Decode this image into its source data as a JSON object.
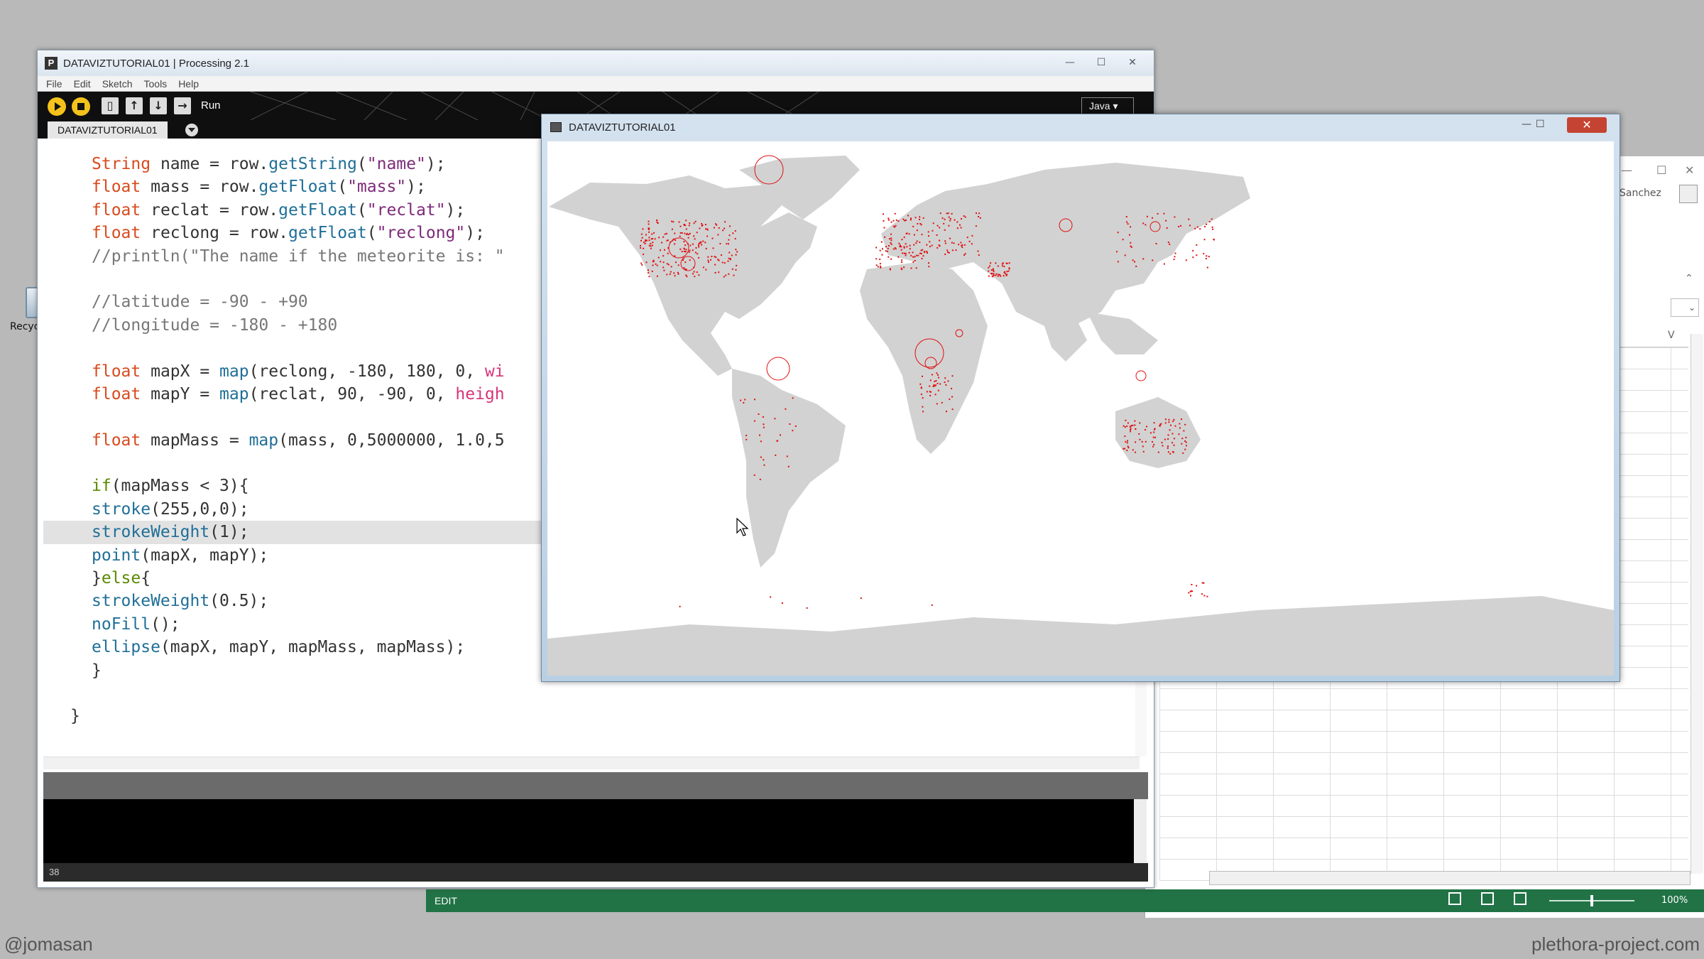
{
  "desktop": {
    "recycle_label": "Recycle"
  },
  "ide": {
    "title": "DATAVIZTUTORIAL01 | Processing 2.1",
    "menu": [
      "File",
      "Edit",
      "Sketch",
      "Tools",
      "Help"
    ],
    "run_label": "Run",
    "mode": "Java",
    "tab": "DATAVIZTUTORIAL01",
    "line_number": "38",
    "code": [
      {
        "indent": 1,
        "parts": [
          [
            "type",
            "String"
          ],
          [
            "plain",
            " name = row."
          ],
          [
            "fn",
            "getString"
          ],
          [
            "plain",
            "("
          ],
          [
            "str",
            "\"name\""
          ],
          [
            "plain",
            ");"
          ]
        ]
      },
      {
        "indent": 1,
        "parts": [
          [
            "type",
            "float"
          ],
          [
            "plain",
            " mass = row."
          ],
          [
            "fn",
            "getFloat"
          ],
          [
            "plain",
            "("
          ],
          [
            "str",
            "\"mass\""
          ],
          [
            "plain",
            ");"
          ]
        ]
      },
      {
        "indent": 1,
        "parts": [
          [
            "type",
            "float"
          ],
          [
            "plain",
            " reclat = row."
          ],
          [
            "fn",
            "getFloat"
          ],
          [
            "plain",
            "("
          ],
          [
            "str",
            "\"reclat\""
          ],
          [
            "plain",
            ");"
          ]
        ]
      },
      {
        "indent": 1,
        "parts": [
          [
            "type",
            "float"
          ],
          [
            "plain",
            " reclong = row."
          ],
          [
            "fn",
            "getFloat"
          ],
          [
            "plain",
            "("
          ],
          [
            "str",
            "\"reclong\""
          ],
          [
            "plain",
            ");"
          ]
        ]
      },
      {
        "indent": 1,
        "parts": [
          [
            "cm",
            "//println(\"The name if the meteorite is: \""
          ]
        ]
      },
      {
        "indent": 1,
        "parts": []
      },
      {
        "indent": 1,
        "parts": [
          [
            "cm",
            "//latitude = -90 - +90"
          ]
        ]
      },
      {
        "indent": 1,
        "parts": [
          [
            "cm",
            "//longitude = -180 - +180"
          ]
        ]
      },
      {
        "indent": 1,
        "parts": []
      },
      {
        "indent": 1,
        "parts": [
          [
            "type",
            "float"
          ],
          [
            "plain",
            " mapX = "
          ],
          [
            "fn",
            "map"
          ],
          [
            "plain",
            "(reclong, -180, 180, 0, "
          ],
          [
            "var",
            "wi"
          ]
        ]
      },
      {
        "indent": 1,
        "parts": [
          [
            "type",
            "float"
          ],
          [
            "plain",
            " mapY = "
          ],
          [
            "fn",
            "map"
          ],
          [
            "plain",
            "(reclat, 90, -90, 0, "
          ],
          [
            "var",
            "heigh"
          ]
        ]
      },
      {
        "indent": 1,
        "parts": []
      },
      {
        "indent": 1,
        "parts": [
          [
            "type",
            "float"
          ],
          [
            "plain",
            " mapMass = "
          ],
          [
            "fn",
            "map"
          ],
          [
            "plain",
            "(mass, 0,5000000, 1.0,5"
          ]
        ]
      },
      {
        "indent": 1,
        "parts": []
      },
      {
        "indent": 1,
        "parts": [
          [
            "ctl",
            "if"
          ],
          [
            "plain",
            "(mapMass < 3){"
          ]
        ]
      },
      {
        "indent": 1,
        "parts": [
          [
            "fn",
            "stroke"
          ],
          [
            "plain",
            "(255,0,0);"
          ]
        ]
      },
      {
        "indent": 1,
        "hl": true,
        "parts": [
          [
            "fn",
            "strokeWeight"
          ],
          [
            "plain",
            "(1);"
          ]
        ]
      },
      {
        "indent": 1,
        "parts": [
          [
            "fn",
            "point"
          ],
          [
            "plain",
            "(mapX, mapY);"
          ]
        ]
      },
      {
        "indent": 1,
        "parts": [
          [
            "plain",
            "}"
          ],
          [
            "ctl",
            "else"
          ],
          [
            "plain",
            "{"
          ]
        ]
      },
      {
        "indent": 1,
        "parts": [
          [
            "fn",
            "strokeWeight"
          ],
          [
            "plain",
            "(0.5);"
          ]
        ]
      },
      {
        "indent": 1,
        "parts": [
          [
            "fn",
            "noFill"
          ],
          [
            "plain",
            "();"
          ]
        ]
      },
      {
        "indent": 1,
        "parts": [
          [
            "fn",
            "ellipse"
          ],
          [
            "plain",
            "(mapX, mapY, mapMass, mapMass);"
          ]
        ]
      },
      {
        "indent": 1,
        "parts": [
          [
            "plain",
            "}"
          ]
        ]
      },
      {
        "indent": 1,
        "parts": []
      },
      {
        "indent": 0,
        "parts": [
          [
            "plain",
            "}"
          ]
        ]
      }
    ]
  },
  "sketch": {
    "title": "DATAVIZTUTORIAL01",
    "close": "✕"
  },
  "excel": {
    "user": "Sanchez",
    "status_mode": "EDIT",
    "zoom": "100%"
  },
  "footer": {
    "left": "@jomasan",
    "right": "plethora-project.com"
  },
  "colors": {
    "meteorite": "#e01010",
    "land": "#d2d2d2",
    "excel_green": "#217346"
  }
}
